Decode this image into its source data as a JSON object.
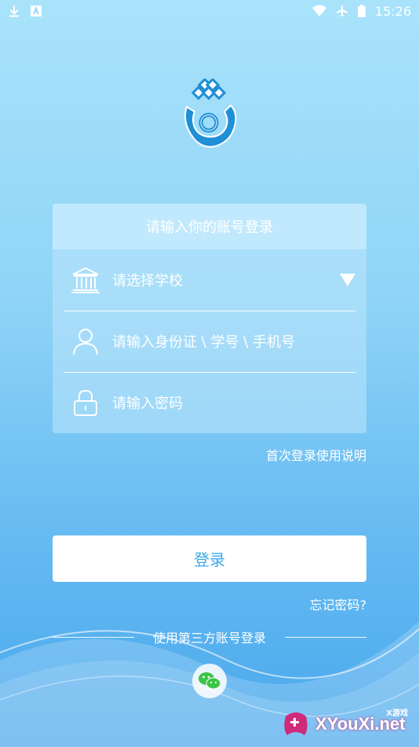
{
  "status_bar": {
    "time": "15:26",
    "left_icons": [
      "download-icon",
      "a-notification-icon"
    ],
    "right_icons": [
      "wifi-icon",
      "airplane-icon",
      "battery-icon"
    ]
  },
  "colors": {
    "accent": "#3da8e6",
    "bg_top": "#a9e3fb",
    "bg_bottom": "#4aa8ec",
    "wechat_green": "#3cc447"
  },
  "card": {
    "header": "请输入你的账号登录",
    "school_placeholder": "请选择学校",
    "account_placeholder": "请输入身份证 \\ 学号 \\ 手机号",
    "password_placeholder": "请输入密码"
  },
  "first_login_help": "首次登录使用说明",
  "login_button": "登录",
  "forgot_password": "忘记密码?",
  "third_party_label": "使用第三方账号登录",
  "watermark": {
    "brand": "XYouXi.net",
    "small": "X游戏"
  }
}
